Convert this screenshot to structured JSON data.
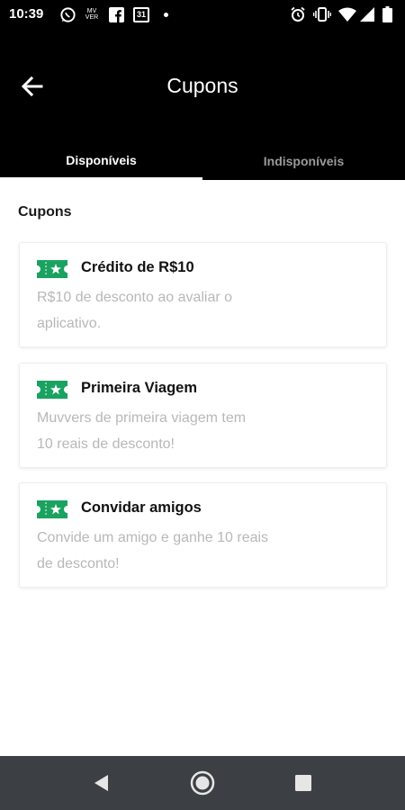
{
  "status_bar": {
    "time": "10:39",
    "left_icons": [
      "whatsapp-icon",
      "mv-icon",
      "facebook-icon",
      "calendar-icon"
    ],
    "calendar_day": "31",
    "right_icons": [
      "alarm-icon",
      "vibrate-icon",
      "wifi-icon",
      "signal-icon",
      "battery-icon"
    ]
  },
  "header": {
    "title": "Cupons",
    "back_icon": "arrow-left-icon"
  },
  "tabs": [
    {
      "label": "Disponíveis",
      "active": true
    },
    {
      "label": "Indisponíveis",
      "active": false
    }
  ],
  "section": {
    "heading": "Cupons"
  },
  "coupons": [
    {
      "title": "Crédito de R$10",
      "desc_line1": "R$10 de desconto ao avaliar o",
      "desc_line2": "aplicativo."
    },
    {
      "title": "Primeira Viagem",
      "desc_line1": "Muvvers de primeira viagem tem",
      "desc_line2": "10 reais de desconto!"
    },
    {
      "title": "Convidar amigos",
      "desc_line1": "Convide um amigo e ganhe 10 reais",
      "desc_line2": "de desconto!"
    }
  ],
  "colors": {
    "accent_green": "#1aa260",
    "header_bg": "#000000",
    "nav_bg": "#3c4044"
  },
  "nav_bar": {
    "icons": [
      "back-triangle-icon",
      "home-circle-icon",
      "recents-square-icon"
    ]
  }
}
